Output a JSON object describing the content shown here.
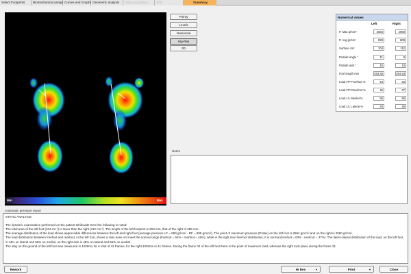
{
  "tabs": [
    {
      "label": "Select Footprints",
      "state": "normal"
    },
    {
      "label": "Biomechanical analysis",
      "state": "normal"
    },
    {
      "label": "Curves and Graphs",
      "state": "normal"
    },
    {
      "label": "Geometric analysis",
      "state": "normal"
    },
    {
      "label": "Video acquisition",
      "state": "disabled"
    },
    {
      "label": "3PD",
      "state": "disabled"
    },
    {
      "label": "Summary",
      "state": "active"
    }
  ],
  "scan": {
    "scale_min": "Min",
    "scale_max": "Max"
  },
  "view_buttons": [
    {
      "label": "Pointy",
      "pressed": false
    },
    {
      "label": "Levels",
      "pressed": false
    },
    {
      "label": "Numerical",
      "pressed": false
    },
    {
      "label": "Hig-Res",
      "pressed": true
    },
    {
      "label": "3D",
      "pressed": false
    }
  ],
  "numerical": {
    "title": "Numerical values",
    "left_header": "Left",
    "right_header": "Right",
    "rows": [
      {
        "label": "P. Max gr/cm²",
        "left": "2584",
        "right": "2060"
      },
      {
        "label": "P. Avg gr/cm²",
        "left": "893",
        "right": "809"
      },
      {
        "label": "Surface cm²",
        "left": "104",
        "right": "112"
      },
      {
        "label": "Podalic angle °",
        "left": "11",
        "right": "9"
      },
      {
        "label": "Podalic axis °",
        "left": "15",
        "right": "14"
      },
      {
        "label": "Foot length mm",
        "left": "253.45",
        "right": "254.93"
      },
      {
        "label": "Load F/P Forefoot %",
        "left": "54",
        "right": "63"
      },
      {
        "label": "Load F/P Rearfoot %",
        "left": "46",
        "right": "37"
      },
      {
        "label": "Load L/L Medial %",
        "left": "56",
        "right": "55"
      },
      {
        "label": "Load L/L Lateral %",
        "left": "44",
        "right": "45"
      }
    ]
  },
  "notes": {
    "label": "Notes",
    "value": ""
  },
  "report": {
    "label": "Automatic pressure report",
    "lines": [
      "STATIC ANALYSIS",
      "",
      "The dynamic examination performed on the patient Ishikowitz Kerri the following is noted:",
      "The total area of the left foot (104 cm ²) is lower than the right (112 cm ²). The length of the left footprint is 253 mm, that of the right of 255 mm.",
      "The average distribution of the load shows appreciable differences between the left and right foot (average pressure LF = 893 gr/cm² - RF = 809 gr/cm²). The point of maximum pressure (P.Max) on the left foot is 2584 gr/cm² and on the right is 2060 gr/cm².",
      "The load distribution between forefoot and rearfoot, in the left foot, shows a ratio does not meet the normal range (forefoot = 54% - rearfoot = 46%), while in the right rear-forefoot distribution, it is normal  (forefoot = 63% - rearfoot = 37%). The  latero-lateral distribution of the load, on the left foot, is 44% on lateral and 56% on medial, on the right side is 45% on lateral and 55% on medial.",
      "The stay on the ground of the left foot was measured in 1026ms for a total of 42 frames, for the right 1003ms in 41 frames. During the frame 32 of the left foot there is the point of maximum load, whereas the right took place during the frame 31."
    ]
  },
  "buttons": {
    "rework": "Rework",
    "resolution": "Hi Res",
    "print": "Print",
    "close": "Close"
  }
}
